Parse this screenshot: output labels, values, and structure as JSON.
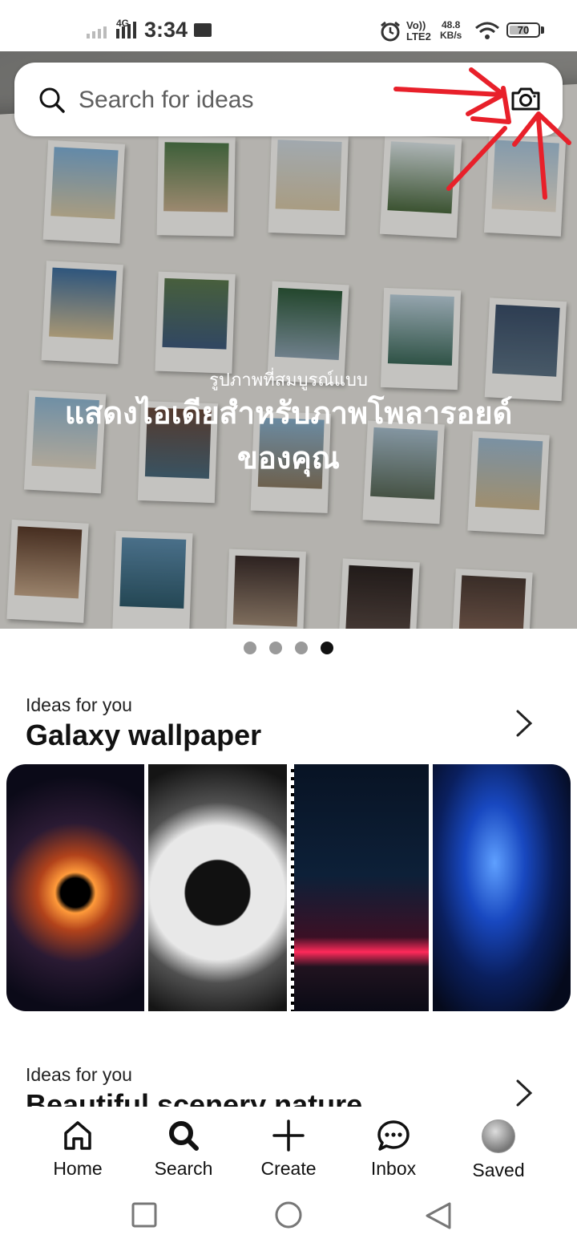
{
  "status_bar": {
    "time": "3:34",
    "network_type": "4G",
    "volte": "Vo)) LTE2",
    "speed_value": "48.8",
    "speed_unit": "KB/s",
    "battery": "70",
    "battery_level": 0.7,
    "icons": [
      "signal-icon",
      "mail-icon",
      "alarm-icon",
      "wifi-icon",
      "battery-icon"
    ]
  },
  "search": {
    "placeholder": "Search for ideas",
    "value": "",
    "icons": [
      "search-icon",
      "camera-icon"
    ]
  },
  "hero": {
    "subtitle": "รูปภาพที่สมบูรณ์แบบ",
    "title": "แสดงไอเดียสำหรับภาพโพลารอยด์ของคุณ",
    "carousel": {
      "count": 4,
      "active_index": 3
    }
  },
  "annotation": {
    "arrow_color": "#e8202a"
  },
  "sections": [
    {
      "kicker": "Ideas for you",
      "title": "Galaxy wallpaper"
    },
    {
      "kicker": "Ideas for you",
      "title": "Beautiful scenery nature"
    }
  ],
  "bottom_nav": [
    {
      "label": "Home",
      "icon": "home-icon"
    },
    {
      "label": "Search",
      "icon": "search-icon",
      "active": true
    },
    {
      "label": "Create",
      "icon": "plus-icon"
    },
    {
      "label": "Inbox",
      "icon": "chat-icon"
    },
    {
      "label": "Saved",
      "icon": "avatar"
    }
  ],
  "system_nav": [
    "recents-button",
    "home-button",
    "back-button"
  ]
}
